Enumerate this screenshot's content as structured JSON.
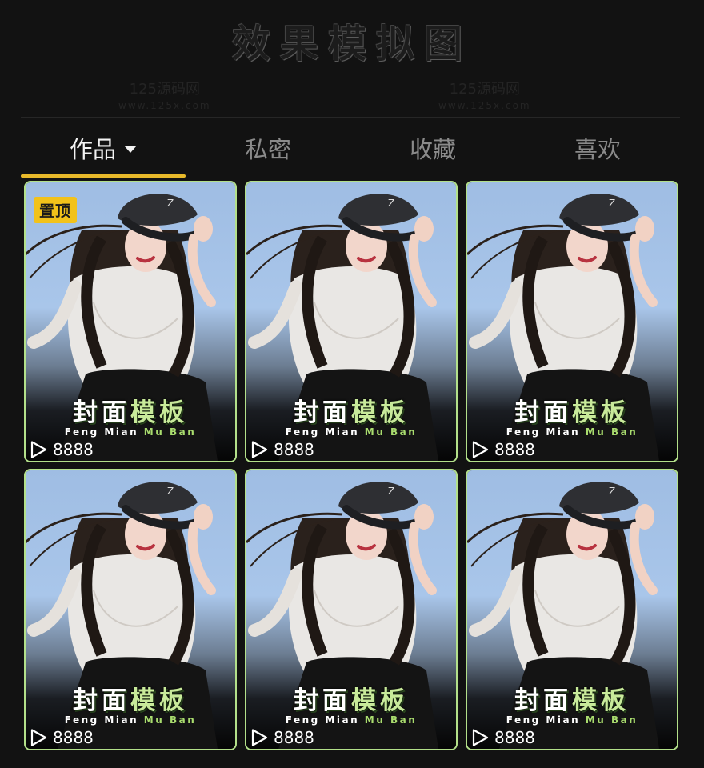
{
  "header": {
    "title": "效果模拟图"
  },
  "watermarks": [
    {
      "line1": "125源码网",
      "line2": "www.125x.com"
    },
    {
      "line1": "125源码网",
      "line2": "www.125x.com"
    }
  ],
  "tabs": [
    {
      "label": "作品",
      "active": true,
      "has_dropdown": true
    },
    {
      "label": "私密",
      "active": false
    },
    {
      "label": "收藏",
      "active": false
    },
    {
      "label": "喜欢",
      "active": false
    }
  ],
  "colors": {
    "accent_tab_underline": "#e8b92a",
    "card_border": "#b3e08a",
    "pin_badge": "#f2c21a",
    "title_accent": "#c8ea9a"
  },
  "cards": [
    {
      "pinned": true,
      "pin_label": "置顶",
      "title_plain": "封面",
      "title_accent": "模板",
      "sub_plain": "Feng Mian",
      "sub_accent": "Mu Ban",
      "plays": "8888",
      "icon": "play-icon"
    },
    {
      "pinned": false,
      "title_plain": "封面",
      "title_accent": "模板",
      "sub_plain": "Feng Mian",
      "sub_accent": "Mu Ban",
      "plays": "8888",
      "icon": "play-icon"
    },
    {
      "pinned": false,
      "title_plain": "封面",
      "title_accent": "模板",
      "sub_plain": "Feng Mian",
      "sub_accent": "Mu Ban",
      "plays": "8888",
      "icon": "play-icon"
    },
    {
      "pinned": false,
      "title_plain": "封面",
      "title_accent": "模板",
      "sub_plain": "Feng Mian",
      "sub_accent": "Mu Ban",
      "plays": "8888",
      "icon": "play-icon"
    },
    {
      "pinned": false,
      "title_plain": "封面",
      "title_accent": "模板",
      "sub_plain": "Feng Mian",
      "sub_accent": "Mu Ban",
      "plays": "8888",
      "icon": "play-icon"
    },
    {
      "pinned": false,
      "title_plain": "封面",
      "title_accent": "模板",
      "sub_plain": "Feng Mian",
      "sub_accent": "Mu Ban",
      "plays": "8888",
      "icon": "play-icon"
    }
  ]
}
